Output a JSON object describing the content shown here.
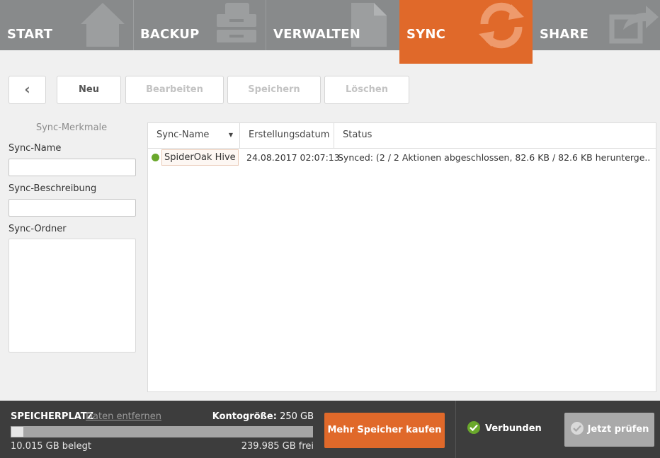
{
  "nav": {
    "tabs": [
      {
        "label": "START",
        "icon": "home-icon"
      },
      {
        "label": "BACKUP",
        "icon": "archive-icon"
      },
      {
        "label": "VERWALTEN",
        "icon": "document-icon"
      },
      {
        "label": "SYNC",
        "icon": "sync-icon",
        "active": true
      },
      {
        "label": "SHARE",
        "icon": "share-icon"
      }
    ]
  },
  "toolbar": {
    "back_label": "‹",
    "new_label": "Neu",
    "edit_label": "Bearbeiten",
    "save_label": "Speichern",
    "delete_label": "Löschen"
  },
  "details": {
    "heading": "Sync-Merkmale",
    "name_label": "Sync-Name",
    "name_value": "",
    "description_label": "Sync-Beschreibung",
    "description_value": "",
    "folder_label": "Sync-Ordner"
  },
  "table": {
    "headers": [
      "Sync-Name",
      "Erstellungsdatum",
      "Status"
    ],
    "rows": [
      {
        "name": "SpiderOak Hive",
        "created": "24.08.2017 02:07:13",
        "status": "Synced: (2 / 2 Aktionen abgeschlossen, 82.6 KB / 82.6 KB herunterge..",
        "status_color": "#6aa82c"
      }
    ]
  },
  "bottom": {
    "storage_title": "SPEICHERPLATZ",
    "remove_data_link": "Daten entfernen",
    "account_size_label": "Kontogröße:",
    "account_size_value": "250 GB",
    "used": "10.015 GB belegt",
    "free": "239.985 GB frei",
    "usage_fraction": 0.04,
    "buy_button": "Mehr Speicher kaufen",
    "connection_status": "Verbunden",
    "check_button": "Jetzt prüfen"
  },
  "colors": {
    "accent": "#e0692a",
    "nav_bg": "#888a8b",
    "bottom_bg": "#3d3d3d",
    "ok_green": "#6aa82c"
  }
}
